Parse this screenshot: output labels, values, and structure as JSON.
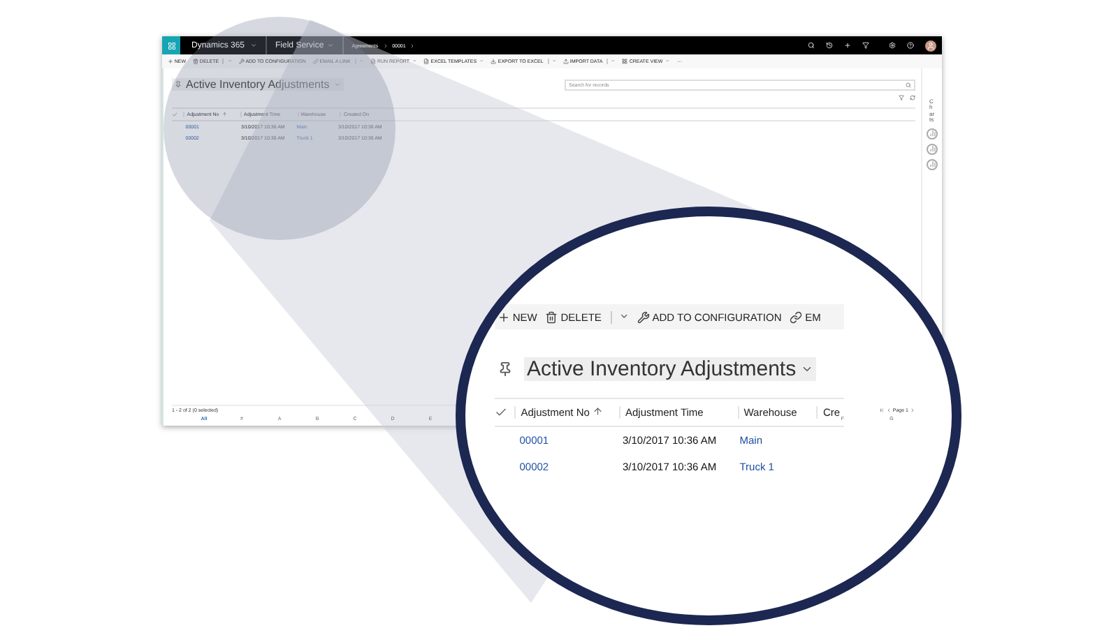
{
  "app_bar": {
    "app_name": "Dynamics 365",
    "area": "Field Service",
    "breadcrumb": [
      "Agreements",
      "00001"
    ]
  },
  "command_bar": [
    {
      "label": "NEW",
      "kind": "new",
      "dropdown": false,
      "split": false
    },
    {
      "label": "DELETE",
      "kind": "delete",
      "dropdown": true,
      "split": true
    },
    {
      "label": "ADD TO CONFIGURATION",
      "kind": "configure",
      "dropdown": false,
      "split": false
    },
    {
      "label": "EMAIL A LINK",
      "kind": "link",
      "dropdown": true,
      "split": true
    },
    {
      "label": "RUN REPORT",
      "kind": "report",
      "dropdown": true,
      "split": false
    },
    {
      "label": "EXCEL TEMPLATES",
      "kind": "template",
      "dropdown": true,
      "split": false
    },
    {
      "label": "EXPORT TO EXCEL",
      "kind": "export",
      "dropdown": true,
      "split": true
    },
    {
      "label": "IMPORT DATA",
      "kind": "import",
      "dropdown": true,
      "split": true
    },
    {
      "label": "CREATE VIEW",
      "kind": "view",
      "dropdown": true,
      "split": false
    },
    {
      "label": "···",
      "kind": "more",
      "dropdown": false,
      "split": false
    }
  ],
  "view_title": "Active Inventory Adjustments",
  "search": {
    "placeholder": "Search for records"
  },
  "columns": [
    {
      "label": "Adjustment No",
      "sorted": true
    },
    {
      "label": "Adjustment Time",
      "sorted": false
    },
    {
      "label": "Warehouse",
      "sorted": false
    },
    {
      "label": "Created On",
      "sorted": false
    }
  ],
  "rows": [
    {
      "adjustment_no": "00001",
      "adjustment_time": "3/10/2017 10:36 AM",
      "warehouse": "Main",
      "created_on": "3/10/2017 10:36 AM"
    },
    {
      "adjustment_no": "00002",
      "adjustment_time": "3/10/2017 10:36 AM",
      "warehouse": "Truck 1",
      "created_on": "3/10/2017 10:36 AM"
    }
  ],
  "charts_pane": {
    "label": "Charts"
  },
  "status_bar": {
    "record_count": "1 - 2 of 2 (0 selected)",
    "pager": "Page 1"
  },
  "index_letters_left": [
    {
      "label": "All",
      "selected": true
    },
    {
      "label": "#",
      "selected": false
    },
    {
      "label": "A",
      "selected": false
    },
    {
      "label": "B",
      "selected": false
    },
    {
      "label": "C",
      "selected": false
    },
    {
      "label": "D",
      "selected": false
    },
    {
      "label": "E",
      "selected": false
    }
  ],
  "index_letters_right": [
    {
      "label": "F",
      "selected": false
    },
    {
      "label": "G",
      "selected": false
    }
  ],
  "magnifier": {
    "command_bar": [
      {
        "label": "NEW",
        "kind": "new",
        "dropdown": false,
        "split": false
      },
      {
        "label": "DELETE",
        "kind": "delete",
        "dropdown": true,
        "split": true
      },
      {
        "label": "ADD TO CONFIGURATION",
        "kind": "configure",
        "dropdown": false,
        "split": false
      },
      {
        "label": "EM",
        "kind": "link",
        "dropdown": false,
        "split": false
      }
    ],
    "view_title": "Active Inventory Adjustments",
    "columns": [
      {
        "label": "Adjustment No",
        "sorted": true
      },
      {
        "label": "Adjustment Time",
        "sorted": false
      },
      {
        "label": "Warehouse",
        "sorted": false
      },
      {
        "label": "Cre"
      }
    ],
    "rows": [
      {
        "adjustment_no": "00001",
        "adjustment_time": "3/10/2017 10:36 AM",
        "warehouse": "Main"
      },
      {
        "adjustment_no": "00002",
        "adjustment_time": "3/10/2017 10:36 AM",
        "warehouse": "Truck 1"
      }
    ]
  }
}
